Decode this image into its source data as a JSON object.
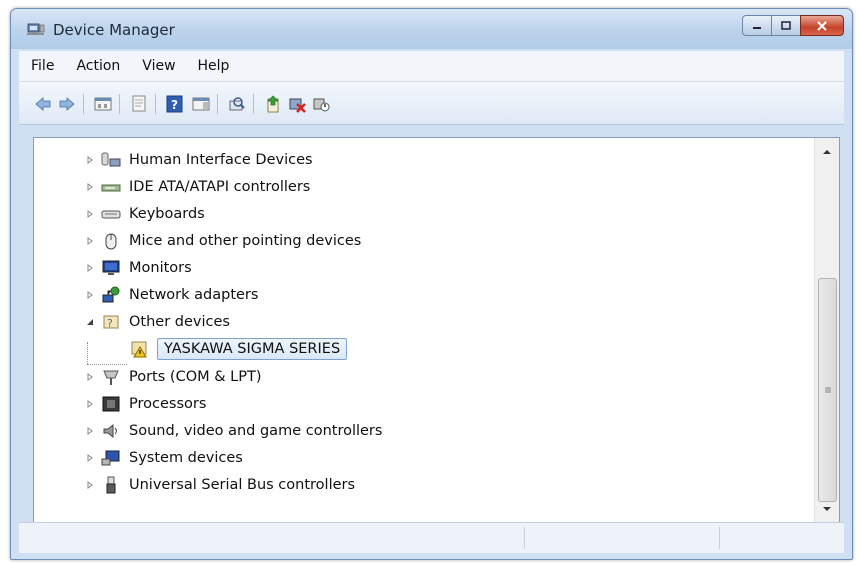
{
  "window": {
    "title": "Device Manager"
  },
  "menu": [
    "File",
    "Action",
    "View",
    "Help"
  ],
  "toolbar_icons": [
    "back-icon",
    "forward-icon",
    "show-hide-console-tree-icon",
    "properties-icon",
    "help-icon",
    "action-pane-icon",
    "scan-hardware-icon",
    "update-driver-icon",
    "uninstall-icon",
    "disable-icon"
  ],
  "tree": {
    "items": [
      {
        "label": "Human Interface Devices",
        "icon": "hid-icon",
        "expanded": false
      },
      {
        "label": "IDE ATA/ATAPI controllers",
        "icon": "ide-controller-icon",
        "expanded": false
      },
      {
        "label": "Keyboards",
        "icon": "keyboard-icon",
        "expanded": false
      },
      {
        "label": "Mice and other pointing devices",
        "icon": "mouse-icon",
        "expanded": false
      },
      {
        "label": "Monitors",
        "icon": "monitor-icon",
        "expanded": false
      },
      {
        "label": "Network adapters",
        "icon": "network-adapter-icon",
        "expanded": false
      },
      {
        "label": "Other devices",
        "icon": "other-devices-icon",
        "expanded": true
      },
      {
        "label": "YASKAWA SIGMA SERIES",
        "icon": "warning-device-icon",
        "child": true,
        "selected": true
      },
      {
        "label": "Ports (COM & LPT)",
        "icon": "port-icon",
        "expanded": false
      },
      {
        "label": "Processors",
        "icon": "processor-icon",
        "expanded": false
      },
      {
        "label": "Sound, video and game controllers",
        "icon": "sound-icon",
        "expanded": false
      },
      {
        "label": "System devices",
        "icon": "system-devices-icon",
        "expanded": false
      },
      {
        "label": "Universal Serial Bus controllers",
        "icon": "usb-icon",
        "expanded": false
      }
    ]
  },
  "colors": {
    "accent": "#3c7fd0",
    "warning": "#f0c419",
    "close": "#c6432b",
    "selection": "#d9e8f8"
  }
}
